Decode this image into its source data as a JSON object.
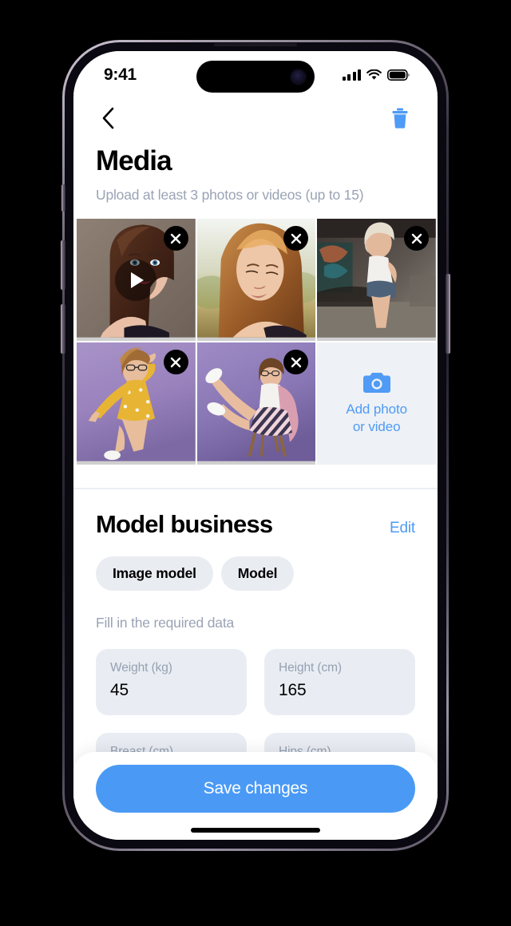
{
  "status_bar": {
    "time": "9:41",
    "signal_icon": "cellular-signal-icon",
    "wifi_icon": "wifi-icon",
    "battery_icon": "battery-icon"
  },
  "nav": {
    "back_icon": "chevron-left-icon",
    "delete_icon": "trash-icon",
    "accent_color": "#4f9bf5"
  },
  "media_section": {
    "title": "Media",
    "subtitle": "Upload at least 3 photos or videos (up to 15)",
    "tiles": [
      {
        "name": "media-tile-1",
        "type": "video",
        "remove_icon": "close-icon",
        "play_icon": "play-icon",
        "alt": "Brunette model holding long hair"
      },
      {
        "name": "media-tile-2",
        "type": "photo",
        "remove_icon": "close-icon",
        "alt": "Model with wavy hair in golden field"
      },
      {
        "name": "media-tile-3",
        "type": "photo",
        "remove_icon": "close-icon",
        "alt": "Blonde model in white tee and denim shorts"
      },
      {
        "name": "media-tile-4",
        "type": "photo",
        "remove_icon": "close-icon",
        "alt": "Model in yellow polka dot dress on purple"
      },
      {
        "name": "media-tile-5",
        "type": "photo",
        "remove_icon": "close-icon",
        "alt": "Model on chair in striped skirt on purple"
      }
    ],
    "add_tile": {
      "icon": "camera-icon",
      "label_line1": "Add photo",
      "label_line2": "or video",
      "color": "#4f9bf5",
      "background": "#eef1f5"
    }
  },
  "business_section": {
    "title": "Model business",
    "edit_label": "Edit",
    "chips": [
      {
        "label": "Image model"
      },
      {
        "label": "Model"
      }
    ],
    "required_note": "Fill in the required data",
    "fields": [
      {
        "label": "Weight (kg)",
        "value": "45",
        "placeholder": ""
      },
      {
        "label": "Height (cm)",
        "value": "165",
        "placeholder": ""
      },
      {
        "label": "Breast (cm)",
        "value": "",
        "placeholder": ""
      },
      {
        "label": "Hips (cm)",
        "value": "",
        "placeholder": ""
      }
    ]
  },
  "action_sheet": {
    "save_label": "Save changes",
    "save_color": "#4a9af5"
  }
}
